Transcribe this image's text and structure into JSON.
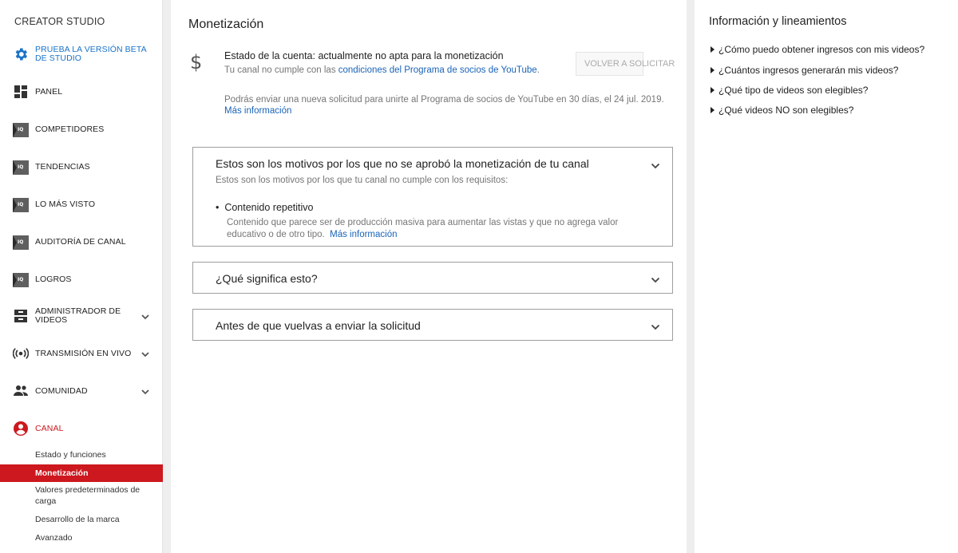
{
  "sidebar": {
    "title": "CREATOR STUDIO",
    "beta_label": "PRUEBA LA VERSIÓN BETA DE STUDIO",
    "items": [
      {
        "label": "PANEL"
      },
      {
        "label": "COMPETIDORES"
      },
      {
        "label": "TENDENCIAS"
      },
      {
        "label": "LO MÁS VISTO"
      },
      {
        "label": "AUDITORÍA DE CANAL"
      },
      {
        "label": "LOGROS"
      },
      {
        "label": "ADMINISTRADOR DE VIDEOS"
      },
      {
        "label": "TRANSMISIÓN EN VIVO"
      },
      {
        "label": "COMUNIDAD"
      },
      {
        "label": "CANAL"
      }
    ],
    "subitems": [
      {
        "label": "Estado y funciones"
      },
      {
        "label": "Monetización"
      },
      {
        "label": "Valores predeterminados de carga"
      },
      {
        "label": "Desarrollo de la marca"
      },
      {
        "label": "Avanzado"
      }
    ]
  },
  "main": {
    "title": "Monetización",
    "status": "Estado de la cuenta: actualmente no apta para la monetización",
    "status_sub_prefix": "Tu canal no cumple con las ",
    "status_sub_link": "condiciones del Programa de socios de YouTube",
    "status_sub_suffix": ".",
    "reapply_button": "VOLVER A SOLICITAR",
    "resubmit_note": "Podrás enviar una nueva solicitud para unirte al Programa de socios de YouTube en 30 días, el 24 jul. 2019.",
    "more_info": "Más información",
    "panels": [
      {
        "title": "Estos son los motivos por los que no se aprobó la monetización de tu canal",
        "subtitle": "Estos son los motivos por los que tu canal no cumple con los requisitos:",
        "bullet_title": "Contenido repetitivo",
        "bullet_desc": "Contenido que parece ser de producción masiva para aumentar las vistas y que no agrega valor educativo o de otro tipo.",
        "bullet_link": "Más información"
      },
      {
        "title": "¿Qué significa esto?"
      },
      {
        "title": "Antes de que vuelvas a enviar la solicitud"
      }
    ]
  },
  "right": {
    "title": "Información y lineamientos",
    "links": [
      {
        "label": "¿Cómo puedo obtener ingresos con mis videos?"
      },
      {
        "label": "¿Cuántos ingresos generarán mis videos?"
      },
      {
        "label": "¿Qué tipo de videos son elegibles?"
      },
      {
        "label": "¿Qué videos NO son elegibles?"
      }
    ]
  },
  "colors": {
    "accent_red": "#cc181e",
    "link_blue": "#1a63b8"
  }
}
